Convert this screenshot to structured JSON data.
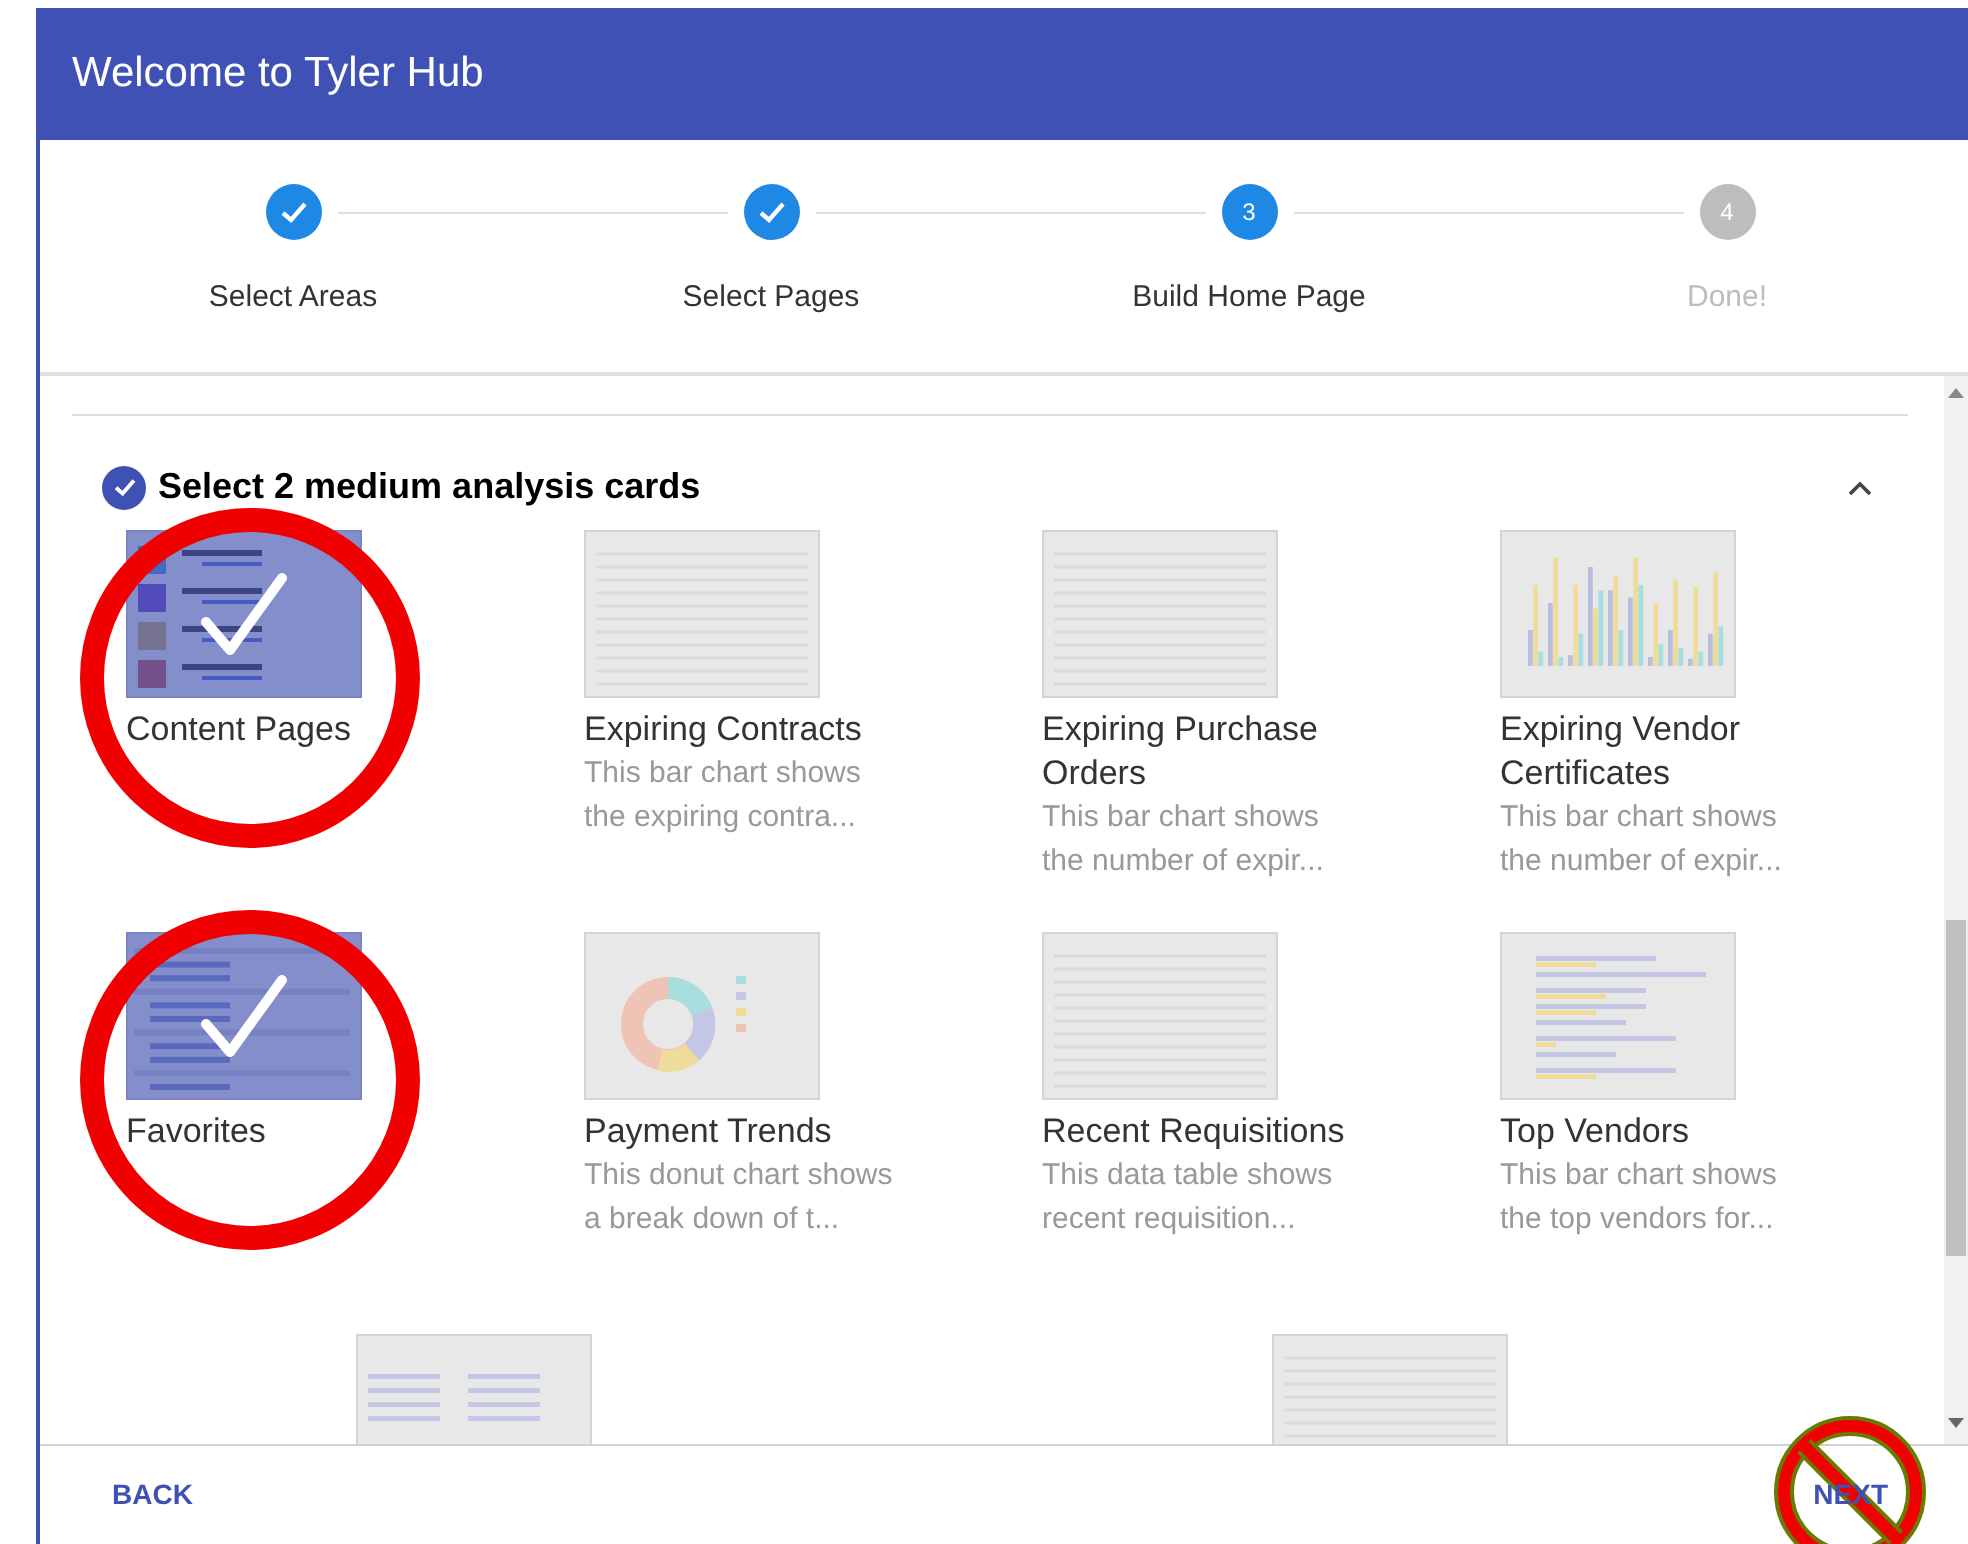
{
  "window": {
    "title": "Welcome to Tyler Hub"
  },
  "steps": [
    {
      "label": "Select Areas",
      "completed": true,
      "selected": false
    },
    {
      "label": "Select Pages",
      "completed": true,
      "selected": false
    },
    {
      "label": "Build Home Page",
      "number": "3",
      "completed": false,
      "selected": true
    },
    {
      "label": "Done!",
      "number": "4",
      "completed": false,
      "selected": false
    }
  ],
  "section": {
    "title": "Select 2 medium analysis cards",
    "complete": true,
    "expanded": true
  },
  "cards": [
    {
      "title": "Content Pages",
      "kind": "content",
      "selected": true,
      "circled": true
    },
    {
      "title": "Expiring Contracts",
      "description": "This bar chart shows the expiring contra...",
      "kind": "table",
      "selected": false,
      "circled": false
    },
    {
      "title": "Expiring Purchase Orders",
      "description": "This bar chart shows the number of expir...",
      "kind": "table",
      "selected": false,
      "circled": false
    },
    {
      "title": "Expiring Vendor Certificates",
      "description": "This bar chart shows the number of expir...",
      "kind": "bars",
      "selected": false,
      "circled": false
    },
    {
      "title": "Favorites",
      "kind": "list",
      "selected": true,
      "circled": true
    },
    {
      "title": "Payment Trends",
      "description": "This donut chart shows a break down of t...",
      "kind": "donut",
      "selected": false,
      "circled": false
    },
    {
      "title": "Recent Requisitions",
      "description": "This data table shows recent requisition...",
      "kind": "table",
      "selected": false,
      "circled": false
    },
    {
      "title": "Top Vendors",
      "description": "This bar chart shows the top vendors for...",
      "kind": "hbars",
      "selected": false,
      "circled": false
    }
  ],
  "partial_cards": [
    {
      "kind": "links"
    },
    {
      "kind": "table"
    }
  ],
  "footer": {
    "back": "BACK",
    "next": {
      "label": "NEXT",
      "crossed_out": true
    }
  }
}
